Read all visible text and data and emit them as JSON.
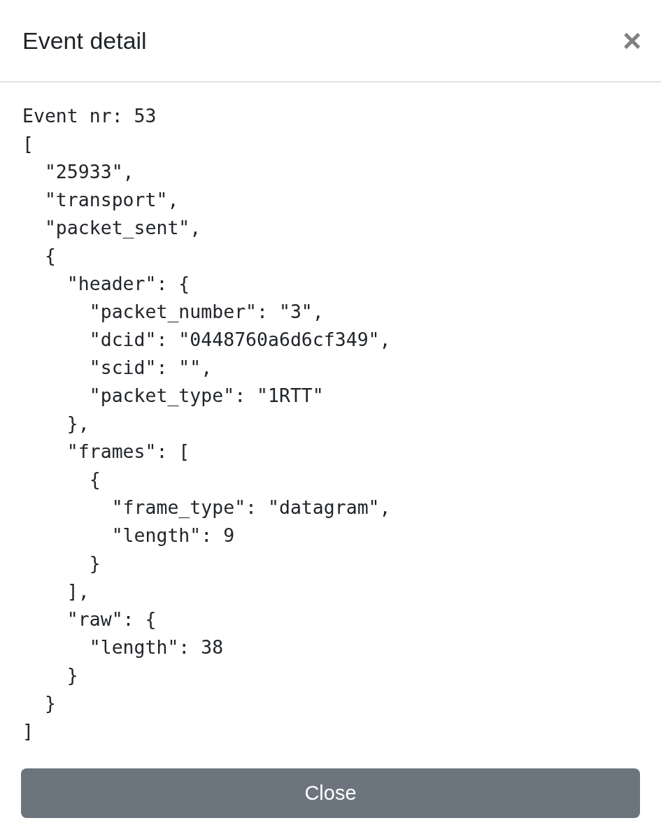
{
  "modal": {
    "title": "Event detail",
    "close_symbol": "×"
  },
  "body": {
    "detail_text": "Event nr: 53\n[\n  \"25933\",\n  \"transport\",\n  \"packet_sent\",\n  {\n    \"header\": {\n      \"packet_number\": \"3\",\n      \"dcid\": \"0448760a6d6cf349\",\n      \"scid\": \"\",\n      \"packet_type\": \"1RTT\"\n    },\n    \"frames\": [\n      {\n        \"frame_type\": \"datagram\",\n        \"length\": 9\n      }\n    ],\n    \"raw\": {\n      \"length\": 38\n    }\n  }\n]"
  },
  "footer": {
    "buttons": [
      "Close"
    ]
  }
}
